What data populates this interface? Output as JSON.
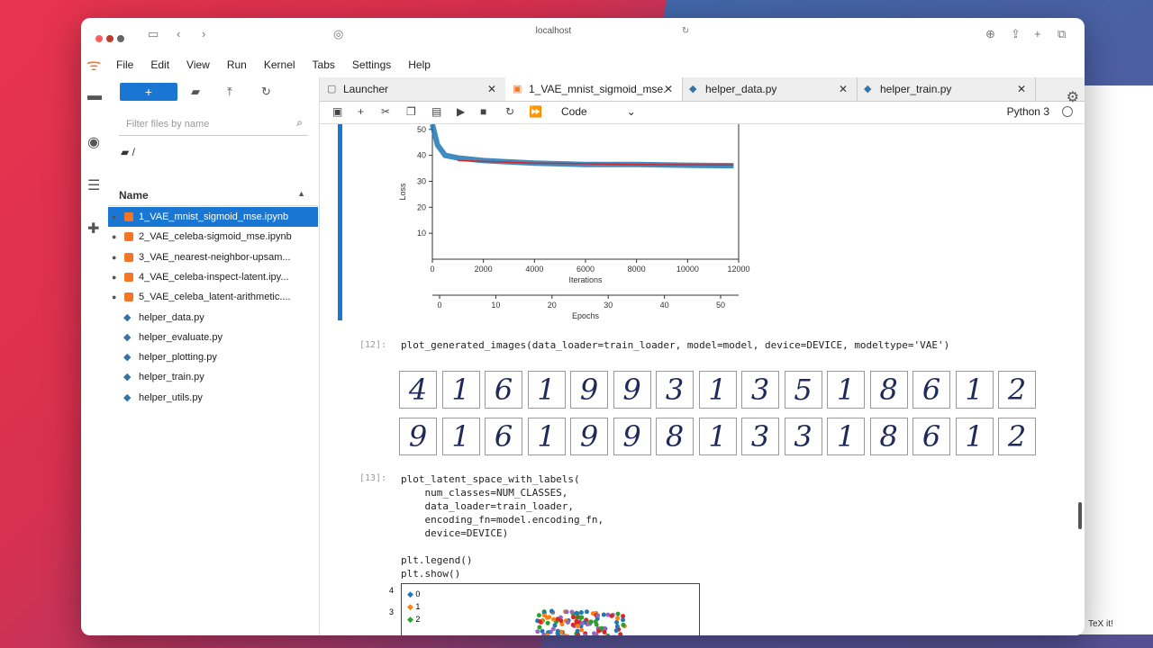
{
  "browser": {
    "url": "localhost"
  },
  "menu": [
    "File",
    "Edit",
    "View",
    "Run",
    "Kernel",
    "Tabs",
    "Settings",
    "Help"
  ],
  "filebrowser": {
    "filter_placeholder": "Filter files by name",
    "path": "/",
    "column_name": "Name",
    "files": [
      {
        "name": "1_VAE_mnist_sigmoid_mse.ipynb",
        "type": "notebook",
        "selected": true,
        "running": true
      },
      {
        "name": "2_VAE_celeba-sigmoid_mse.ipynb",
        "type": "notebook",
        "running": true
      },
      {
        "name": "3_VAE_nearest-neighbor-upsam...",
        "type": "notebook",
        "running": true
      },
      {
        "name": "4_VAE_celeba-inspect-latent.ipy...",
        "type": "notebook",
        "running": true
      },
      {
        "name": "5_VAE_celeba_latent-arithmetic....",
        "type": "notebook",
        "running": true
      },
      {
        "name": "helper_data.py",
        "type": "python"
      },
      {
        "name": "helper_evaluate.py",
        "type": "python"
      },
      {
        "name": "helper_plotting.py",
        "type": "python"
      },
      {
        "name": "helper_train.py",
        "type": "python"
      },
      {
        "name": "helper_utils.py",
        "type": "python"
      }
    ]
  },
  "tabs": [
    {
      "label": "Launcher"
    },
    {
      "label": "1_VAE_mnist_sigmoid_mse."
    },
    {
      "label": "helper_data.py"
    },
    {
      "label": "helper_train.py"
    }
  ],
  "toolbar": {
    "cell_type": "Code",
    "kernel": "Python 3"
  },
  "cells": {
    "plot_generated": "plot_generated_images(data_loader=train_loader, model=model, device=DEVICE, modeltype='VAE')",
    "plot_latent": "plot_latent_space_with_labels(\n    num_classes=NUM_CLASSES,\n    data_loader=train_loader,\n    encoding_fn=model.encoding_fn,\n    device=DEVICE)\n\nplt.legend()\nplt.show()",
    "prompt_generated": "[12]:",
    "prompt_latent": "[13]:"
  },
  "chart_data": {
    "type": "line",
    "ylabel": "Loss",
    "xlabel": "Iterations",
    "x2label": "Epochs",
    "xlim": [
      0,
      12000
    ],
    "ylim": [
      0,
      52
    ],
    "x_ticks": [
      0,
      2000,
      4000,
      6000,
      8000,
      10000,
      12000
    ],
    "y_ticks": [
      10,
      20,
      30,
      40,
      50
    ],
    "epoch_ticks": [
      0,
      10,
      20,
      30,
      40,
      50
    ],
    "series": [
      {
        "values_x": [
          0,
          200,
          500,
          1000,
          2000,
          3000,
          4000,
          6000,
          8000,
          10000,
          11800
        ],
        "values_y": [
          52,
          44,
          40,
          39,
          38,
          37.5,
          37,
          36.5,
          36.5,
          36.2,
          36
        ],
        "color": "#1f77b4"
      },
      {
        "values_x": [
          1000,
          4000,
          8000,
          11800
        ],
        "values_y": [
          38,
          37,
          36.5,
          36.3
        ],
        "color": "#d62728"
      }
    ]
  },
  "generated_digits": {
    "original": [
      "4",
      "1",
      "6",
      "1",
      "9",
      "9",
      "3",
      "1",
      "3",
      "5",
      "1",
      "8",
      "6",
      "1",
      "2"
    ],
    "reconstructed": [
      "9",
      "1",
      "6",
      "1",
      "9",
      "9",
      "8",
      "1",
      "3",
      "3",
      "1",
      "8",
      "6",
      "1",
      "2"
    ]
  },
  "latent_legend": [
    "0",
    "1",
    "2"
  ],
  "latent_y_ticks": [
    "4",
    "3"
  ],
  "right_edge_text": "TeX it!"
}
